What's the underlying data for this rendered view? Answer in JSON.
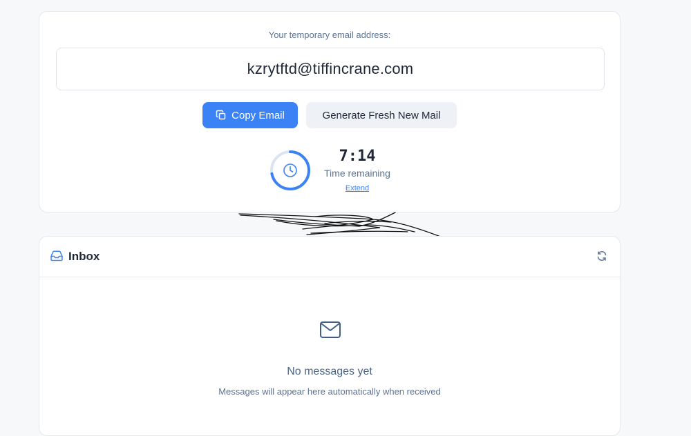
{
  "email_card": {
    "label": "Your temporary email address:",
    "address": "kzrytftd@tiffincrane.com",
    "copy_button": "Copy Email",
    "fresh_button": "Generate Fresh New Mail",
    "timer": {
      "value": "7:14",
      "label": "Time remaining",
      "extend": "Extend",
      "progress_fraction": 0.72
    }
  },
  "inbox": {
    "title": "Inbox",
    "empty_title": "No messages yet",
    "empty_subtitle": "Messages will appear here automatically when received"
  },
  "icons": {
    "copy": "copy-icon",
    "clock": "clock-icon",
    "inbox": "inbox-icon",
    "refresh": "refresh-icon",
    "mail": "mail-icon"
  },
  "colors": {
    "accent": "#3b82f6",
    "muted_text": "#5b7396",
    "background": "#f7f8fa"
  }
}
